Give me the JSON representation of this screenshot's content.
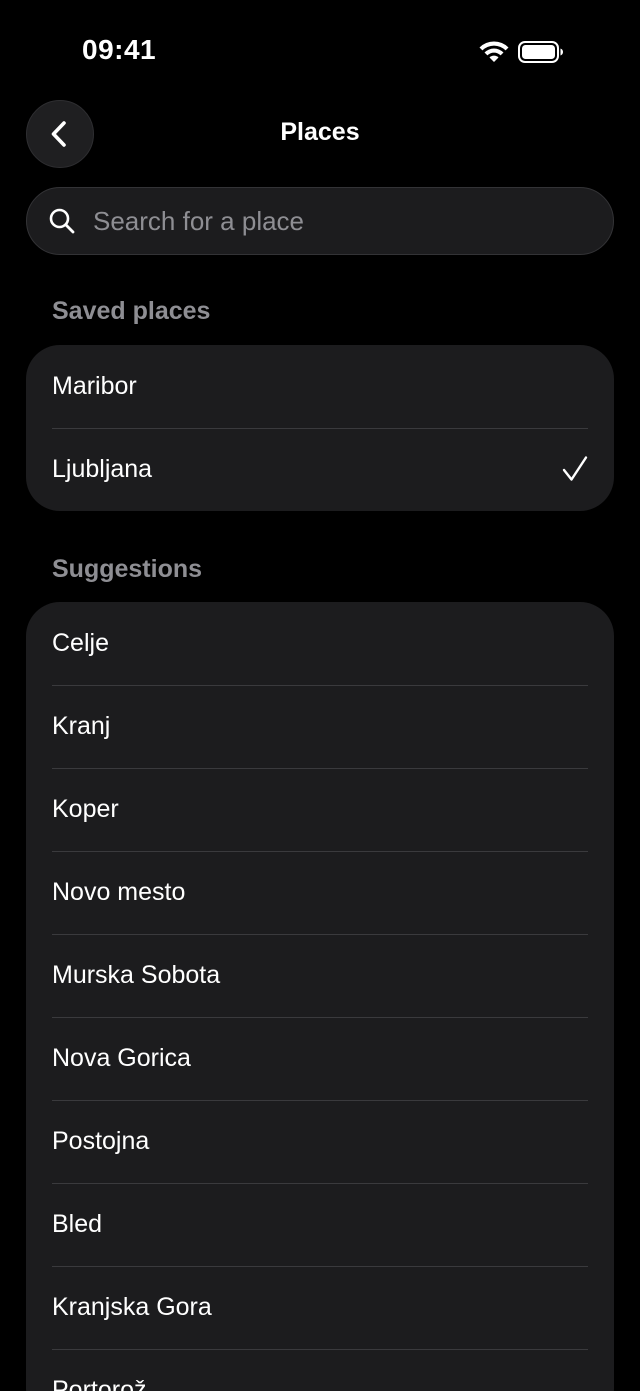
{
  "status_bar": {
    "time": "09:41"
  },
  "nav": {
    "title": "Places",
    "back_icon": "chevron-left-icon"
  },
  "search": {
    "placeholder": "Search for a place",
    "value": ""
  },
  "saved": {
    "header": "Saved places",
    "items": [
      {
        "label": "Maribor",
        "selected": false
      },
      {
        "label": "Ljubljana",
        "selected": true
      }
    ]
  },
  "suggestions": {
    "header": "Suggestions",
    "items": [
      {
        "label": "Celje"
      },
      {
        "label": "Kranj"
      },
      {
        "label": "Koper"
      },
      {
        "label": "Novo mesto"
      },
      {
        "label": "Murska Sobota"
      },
      {
        "label": "Nova Gorica"
      },
      {
        "label": "Postojna"
      },
      {
        "label": "Bled"
      },
      {
        "label": "Kranjska Gora"
      },
      {
        "label": "Portorož"
      }
    ]
  },
  "colors": {
    "background": "#000000",
    "card": "#1c1c1e",
    "secondary_text": "#8e8e93",
    "separator": "#3a3a3d"
  }
}
